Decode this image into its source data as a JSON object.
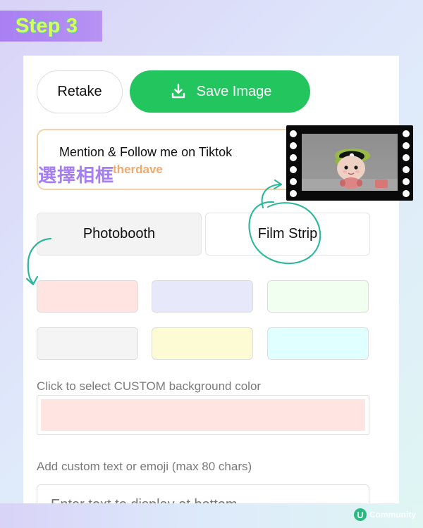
{
  "badge": {
    "text": "Step 3"
  },
  "actions": {
    "retake_label": "Retake",
    "save_label": "Save Image",
    "save_color": "#22c55e"
  },
  "promo": {
    "line1": "Mention & Follow me on Tiktok",
    "handle_visible": "therdave"
  },
  "overlay": {
    "label": "選擇相框",
    "label_color": "#a57ef2",
    "annotation_color": "#2cb79a"
  },
  "frame_tabs": [
    {
      "label": "Photobooth",
      "selected": true
    },
    {
      "label": "Film Strip",
      "selected": false
    }
  ],
  "swatches": [
    "#ffe4e1",
    "#e8e8fb",
    "#f0fff0",
    "#f4f4f4",
    "#fdfbd3",
    "#e0ffff"
  ],
  "custom_color": {
    "label": "Click to select CUSTOM background color",
    "value": "#ffe4e1"
  },
  "custom_text": {
    "label": "Add custom text or emoji (max 80 chars)",
    "placeholder": "Enter text to display at bottom"
  },
  "watermark": {
    "brand": "Community"
  }
}
